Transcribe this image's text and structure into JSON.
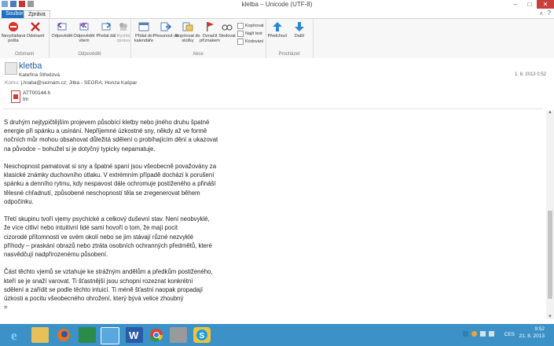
{
  "window": {
    "title": "kletba – Unicode (UTF-8)",
    "controls": [
      "–",
      "□",
      "✕"
    ]
  },
  "ribbon_tabs": [
    {
      "label": "Soubor",
      "active": true
    },
    {
      "label": "Zpráva",
      "active": false
    }
  ],
  "ribbon": {
    "groups": [
      {
        "label": "Odstranit",
        "buttons": [
          {
            "label": "Nevyžádaná pošta",
            "icon": "no-entry-icon"
          },
          {
            "label": "Odstranit",
            "icon": "delete-x-icon"
          }
        ]
      },
      {
        "label": "Odpovědět",
        "buttons": [
          {
            "label": "Odpovědět",
            "icon": "reply-icon"
          },
          {
            "label": "Odpovědět všem",
            "icon": "reply-all-icon"
          },
          {
            "label": "Předat dál",
            "icon": "forward-icon"
          },
          {
            "label": "Rychlá zpráva",
            "icon": "instant-message-icon"
          }
        ]
      },
      {
        "label": "Akce",
        "buttons": [
          {
            "label": "Přidat do kalendáře",
            "icon": "calendar-icon"
          },
          {
            "label": "Přesunout do",
            "icon": "move-to-icon"
          },
          {
            "label": "Kopírovat do složky",
            "icon": "copy-to-folder-icon"
          },
          {
            "label": "Označit příznakem",
            "icon": "flag-icon"
          },
          {
            "label": "Sledovat",
            "icon": "watch-icon"
          }
        ],
        "small": [
          "Kopírovat",
          "Najít text",
          "Kódování"
        ]
      },
      {
        "label": "Procházet",
        "buttons": [
          {
            "label": "Předchozí",
            "icon": "up-arrow-icon"
          },
          {
            "label": "Další",
            "icon": "down-arrow-icon"
          }
        ]
      }
    ]
  },
  "message": {
    "subject": "kletba",
    "sender": "Kateřina Středová",
    "date": "1. 8. 2013 0:52",
    "cc_label": "Komu:",
    "cc": "j.hraba@seznam.cz; Jitka - SEGRA; Honza Kašpar",
    "attachment": {
      "name": "ATT00144.h",
      "ext": "tm"
    },
    "body": "S druhým nejtypičtějším projevem působící kletby nebo jiného druhu špatné\nenergie při spánku a usínání. Nepříjemné úzkostné sny, někdy až ve formě\nnočních můr mohou obsahovat důležitá sdělení o probíhajícím dění a ukazovat\nna původce – bohužel si je dotyčný typicky nepamatuje.\n\nNeschopnost pamatovat si sny a špatné spaní jsou všeobecně považovány za\nklasické známky duchovního útlaku. V extrémním případě dochází k porušení\nspánku a denního rytmu, kdy nespavost dále ochromuje postiženého a přináší\ntělesné chřadnutí, způsobené neschopností těla se zregenerovat během\nodpočinku.\n\nTřetí skupinu tvoří vjemy psychické a celkový duševní stav. Není neobvyklé,\nže více citliví nebo intuitivní lidé sami hovoří o tom, že mají pocit\ncizorodé přítomnosti ve svém okolí nebo se jim stávají různé nezvyklé\npříhody – praskání obrazů nebo ztráta osobních ochranných předmětů, které\nnasvědčují nadpřirozenému působení.\n\nČást těchto vjemů se vztahuje ke strážným andělům a předkům postiženého,\nkteří se je snaží varovat. Ti šťastnější jsou schopni rozeznat konkrétní\nsdělení a zařídit se podle těchto intuicí. Ti méně šťastní naopak propadají\núzkosti a pocitu všeobecného ohrožení, který bývá velice zhoubný\n="
  },
  "taskbar": {
    "apps": [
      "internet-explorer-icon",
      "file-explorer-icon",
      "firefox-icon",
      "excel-icon",
      "live-mail-icon",
      "word-icon",
      "chrome-icon",
      "paint-icon",
      "skype-icon"
    ],
    "lang": "CES",
    "time": "9:52",
    "date": "21. 8. 2013"
  },
  "colors": {
    "accent": "#1e6fc2",
    "taskbar": "#3c91c6",
    "subject": "#1f5b9e"
  }
}
